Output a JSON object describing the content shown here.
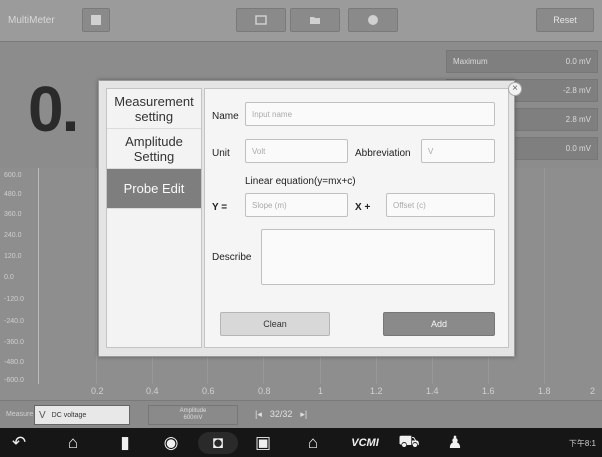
{
  "app": {
    "title": "MultiMeter"
  },
  "toolbar": {
    "reset_label": "Reset"
  },
  "reading": {
    "value": "0."
  },
  "stats": [
    {
      "label": "Maximum",
      "value": "0.0 mV"
    },
    {
      "label": "",
      "value": "-2.8 mV"
    },
    {
      "label": "",
      "value": "2.8 mV"
    },
    {
      "label": "",
      "value": "0.0 mV"
    }
  ],
  "graph": {
    "y_ticks": [
      "600.0",
      "480.0",
      "360.0",
      "240.0",
      "120.0",
      "0.0",
      "-120.0",
      "-240.0",
      "-360.0",
      "-480.0",
      "-600.0"
    ],
    "x_ticks": [
      "0.2",
      "0.4",
      "0.6",
      "0.8",
      "1",
      "1.2",
      "1.4",
      "1.6",
      "1.8",
      "2"
    ]
  },
  "statusbar": {
    "measure_label": "Measure",
    "measure_value": "DC voltage",
    "amplitude_label": "Amplitude",
    "amplitude_value": "600mV",
    "page": "32/32"
  },
  "system": {
    "status": "下午8:1"
  },
  "modal": {
    "close_glyph": "×",
    "tabs": [
      "Measurement setting",
      "Amplitude Setting",
      "Probe Edit"
    ],
    "active_tab": 2,
    "form": {
      "name_label": "Name",
      "name_placeholder": "Input name",
      "unit_label": "Unit",
      "unit_placeholder": "Volt",
      "abbreviation_label": "Abbreviation",
      "abbreviation_placeholder": "V",
      "equation_caption": "Linear equation(y=mx+c)",
      "y_label": "Y  =",
      "slope_placeholder": "Slope (m)",
      "x_label": "X  +",
      "offset_placeholder": "Offset (c)",
      "describe_label": "Describe",
      "clean_label": "Clean",
      "add_label": "Add"
    }
  }
}
